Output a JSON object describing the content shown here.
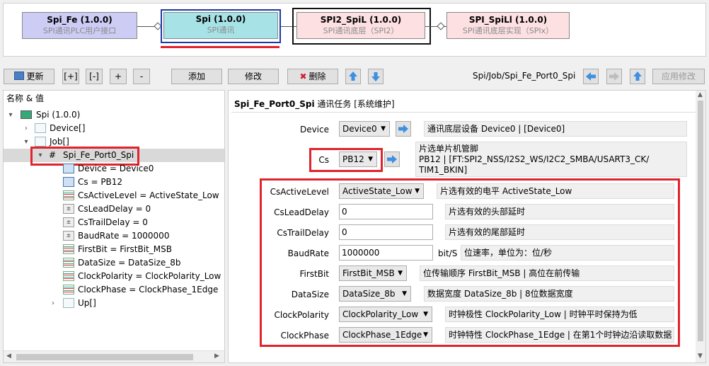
{
  "modules": [
    {
      "title": "Spi_Fe (1.0.0)",
      "subtitle": "SPI通讯PLC用户接口"
    },
    {
      "title": "Spi (1.0.0)",
      "subtitle": "SPI通讯"
    },
    {
      "title": "SPI2_SpiL (1.0.0)",
      "subtitle": "SPI通讯底层（SPI2）"
    },
    {
      "title": "SPI_SpiLl (1.0.0)",
      "subtitle": "SPI通讯底层实现（SPIx）"
    }
  ],
  "toolbar": {
    "refresh": "更新",
    "expand": "[+]",
    "collapse": "[-]",
    "plus": "+",
    "minus": "-",
    "add": "添加",
    "edit": "修改",
    "delete": "删除",
    "path": "Spi/Job/Spi_Fe_Port0_Spi",
    "apply": "应用修改"
  },
  "tree": {
    "header": "名称 & 值",
    "root": "Spi (1.0.0)",
    "device_list": "Device[]",
    "job_list": "Job[]",
    "selected": "Spi_Fe_Port0_Spi",
    "children": [
      "Device = Device0",
      "Cs = PB12",
      "CsActiveLevel = ActiveState_Low",
      "CsLeadDelay = 0",
      "CsTrailDelay = 0",
      "BaudRate = 1000000",
      "FirstBit = FirstBit_MSB",
      "DataSize = DataSize_8b",
      "ClockPolarity = ClockPolarity_Low",
      "ClockPhase = ClockPhase_1Edge"
    ],
    "up": "Up[]"
  },
  "panel": {
    "title": "Spi_Fe_Port0_Spi",
    "title_suffix": " 通讯任务 [系统维护]",
    "device": {
      "label": "Device",
      "value": "Device0",
      "desc": "通讯底层设备 Device0 | [Device0]"
    },
    "cs": {
      "label": "Cs",
      "value": "PB12",
      "desc1": "片选单片机管脚",
      "desc2": "PB12 | [FT:SPI2_NSS/I2S2_WS/I2C2_SMBA/USART3_CK/",
      "desc3": "TIM1_BKIN]"
    },
    "cs_active": {
      "label": "CsActiveLevel",
      "value": "ActiveState_Low",
      "desc": "片选有效的电平 ActiveState_Low"
    },
    "cs_lead": {
      "label": "CsLeadDelay",
      "value": "0",
      "desc": "片选有效的头部延时"
    },
    "cs_trail": {
      "label": "CsTrailDelay",
      "value": "0",
      "desc": "片选有效的尾部延时"
    },
    "baud": {
      "label": "BaudRate",
      "value": "1000000",
      "unit": "bit/S",
      "desc": "位速率，单位为：位/秒"
    },
    "first_bit": {
      "label": "FirstBit",
      "value": "FirstBit_MSB",
      "desc": "位传输顺序 FirstBit_MSB | 高位在前传输"
    },
    "data_size": {
      "label": "DataSize",
      "value": "DataSize_8b",
      "desc": "数据宽度 DataSize_8b | 8位数据宽度"
    },
    "clock_pol": {
      "label": "ClockPolarity",
      "value": "ClockPolarity_Low",
      "desc": "时钟极性 ClockPolarity_Low | 时钟平时保持为低"
    },
    "clock_phase": {
      "label": "ClockPhase",
      "value": "ClockPhase_1Edge",
      "desc": "时钟特性 ClockPhase_1Edge | 在第1个时钟边沿读取数据"
    }
  },
  "colors": {
    "highlight": "#e0242c",
    "selected_module": "#a7e3e6",
    "left_module": "#ccccf5",
    "right_module": "#fde0e2"
  }
}
